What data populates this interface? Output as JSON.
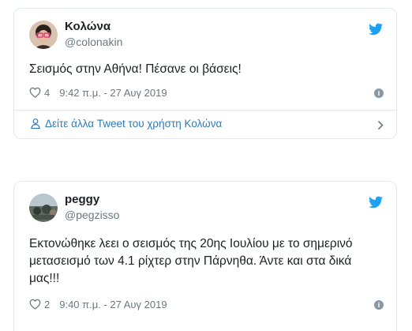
{
  "colors": {
    "twitter_blue": "#1da1f2",
    "link_blue": "#2b7bb9",
    "muted_gray": "#697882",
    "border": "#e1e8ed"
  },
  "tweets": [
    {
      "display_name": "Κολώνα",
      "handle": "@colonakin",
      "text": "Σεισμός στην Αθήνα! Πέσανε οι βάσεις!",
      "likes": "4",
      "timestamp": "9:42 π.μ. - 27 Αυγ 2019",
      "more_link": "Δείτε άλλα Tweet του χρήστη Κολώνα",
      "icons": [
        "avatar",
        "twitter-bird-icon",
        "heart-icon",
        "info-icon",
        "person-icon",
        "chevron-right-icon"
      ]
    },
    {
      "display_name": "peggy",
      "handle": "@pegzisso",
      "text": "Εκτονώθηκε λεει ο σεισμός της 20ης Ιουλίου με το σημερινό μετασεισμό των 4.1 ρίχτερ στην Πάρνηθα. Άντε και στα δικά μας!!!",
      "likes": "2",
      "timestamp": "9:40 π.μ. - 27 Αυγ 2019",
      "icons": [
        "avatar",
        "twitter-bird-icon",
        "heart-icon",
        "info-icon"
      ]
    }
  ]
}
